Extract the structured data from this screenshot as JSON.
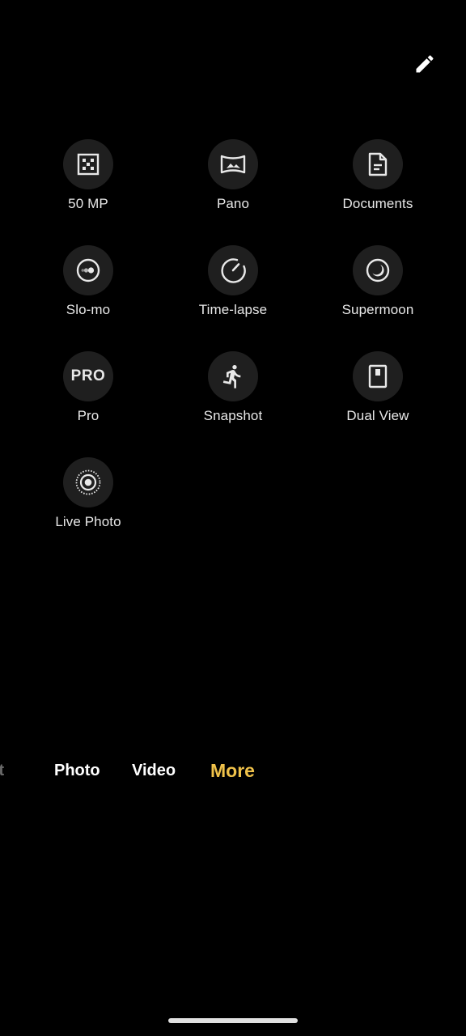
{
  "header": {
    "edit_icon": "pencil-icon"
  },
  "modes": [
    {
      "label": "50 MP",
      "icon": "grid-dots-icon"
    },
    {
      "label": "Pano",
      "icon": "panorama-icon"
    },
    {
      "label": "Documents",
      "icon": "document-icon"
    },
    {
      "label": "Slo-mo",
      "icon": "slow-motion-icon"
    },
    {
      "label": "Time-lapse",
      "icon": "timer-dial-icon"
    },
    {
      "label": "Supermoon",
      "icon": "moon-icon"
    },
    {
      "label": "Pro",
      "icon": "pro-text-icon",
      "icon_text": "PRO"
    },
    {
      "label": "Snapshot",
      "icon": "running-person-icon"
    },
    {
      "label": "Dual View",
      "icon": "dual-view-icon"
    },
    {
      "label": "Live Photo",
      "icon": "live-photo-icon"
    }
  ],
  "tabs": {
    "portrait": "rait",
    "photo": "Photo",
    "video": "Video",
    "more": "More",
    "active": "More"
  },
  "colors": {
    "background": "#000000",
    "icon_circle": "#1f1f1f",
    "active_tab": "#f0c24a",
    "inactive_tab": "#ffffff",
    "faded_tab": "#6a6a6a"
  }
}
